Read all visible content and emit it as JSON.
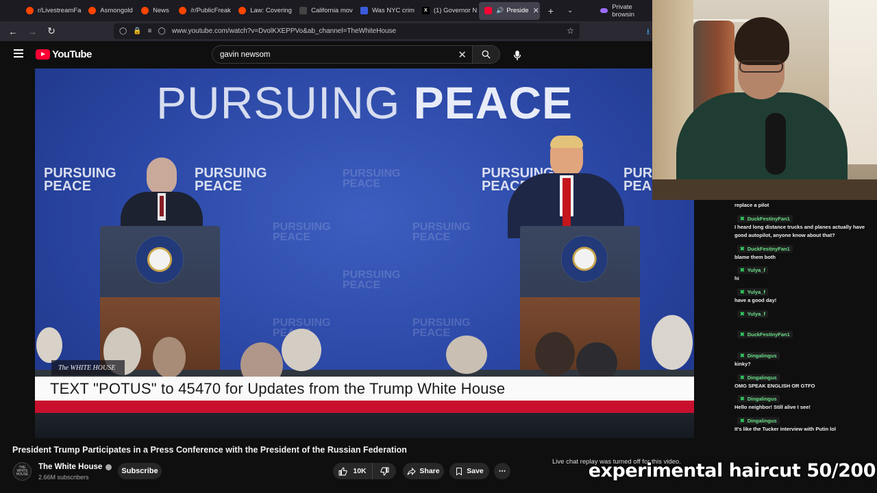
{
  "browser": {
    "tabs": [
      {
        "label": "r/LivestreamFa",
        "color": "#ff4500"
      },
      {
        "label": "Asmongold",
        "color": "#ff4500"
      },
      {
        "label": "News",
        "color": "#ff4500"
      },
      {
        "label": "/r/PublicFreak",
        "color": "#ff4500"
      },
      {
        "label": "Law: Covering",
        "color": "#ff4500"
      },
      {
        "label": "California mov",
        "color": "#444444"
      },
      {
        "label": "Was NYC crim",
        "color": "#3b5bdb"
      },
      {
        "label": "(1) Governor N",
        "color": "#000000"
      },
      {
        "label": "Preside",
        "color": "#ff0033"
      }
    ],
    "private_label": "Private browsin",
    "url": "www.youtube.com/watch?v=DvolKXEPPVo&ab_channel=TheWhiteHouse"
  },
  "youtube": {
    "logo_text": "YouTube",
    "search_value": "gavin newsom"
  },
  "video": {
    "headline_light": "PURSUING",
    "headline_bold": "PEACE",
    "watermark_top": "PURSUING",
    "watermark_bottom": "PEACE",
    "badge": "The WHITE HOUSE",
    "lower_third": "TEXT \"POTUS\" to 45470 for Updates from the Trump White House"
  },
  "meta": {
    "title": "President Trump Participates in a Press Conference with the President of the Russian Federation",
    "channel": "The White House",
    "subscribers": "2.66M subscribers",
    "subscribe_label": "Subscribe",
    "likes": "10K",
    "share_label": "Share",
    "save_label": "Save",
    "more_label": "⋯"
  },
  "chat": {
    "off_notice": "Live chat replay was turned off for this video.",
    "entries": [
      {
        "type": "msg",
        "text": "replace a pilot"
      },
      {
        "type": "user",
        "text": "DuckFestinyFan1"
      },
      {
        "type": "msg",
        "text": "I heard long distance trucks and planes actually have"
      },
      {
        "type": "msg",
        "text": "good autopilot, anyone know about that?"
      },
      {
        "type": "user",
        "text": "DuckFestinyFan1"
      },
      {
        "type": "msg",
        "text": "blame them both"
      },
      {
        "type": "user",
        "text": "Yulya_f"
      },
      {
        "type": "msg",
        "text": "hi"
      },
      {
        "type": "user",
        "text": "Yulya_f"
      },
      {
        "type": "msg",
        "text": "have a good day!"
      },
      {
        "type": "user",
        "text": "Yulya_f"
      },
      {
        "type": "user",
        "text": "DuckFestinyFan1"
      },
      {
        "type": "user",
        "text": "Dingalingus"
      },
      {
        "type": "msg",
        "text": "kinky?"
      },
      {
        "type": "user",
        "text": "Dingalingus"
      },
      {
        "type": "msg",
        "text": "OMG SPEAK ENGLISH OR GTFO"
      },
      {
        "type": "user",
        "text": "Dingalingus"
      },
      {
        "type": "msg",
        "text": "Hello neighbor! Still alive I see!"
      },
      {
        "type": "user",
        "text": "Dingalingus"
      },
      {
        "type": "msg",
        "text": "It's like the Tucker interview with Putin lol"
      }
    ]
  },
  "overlay_text": "experimental haircut 50/200"
}
